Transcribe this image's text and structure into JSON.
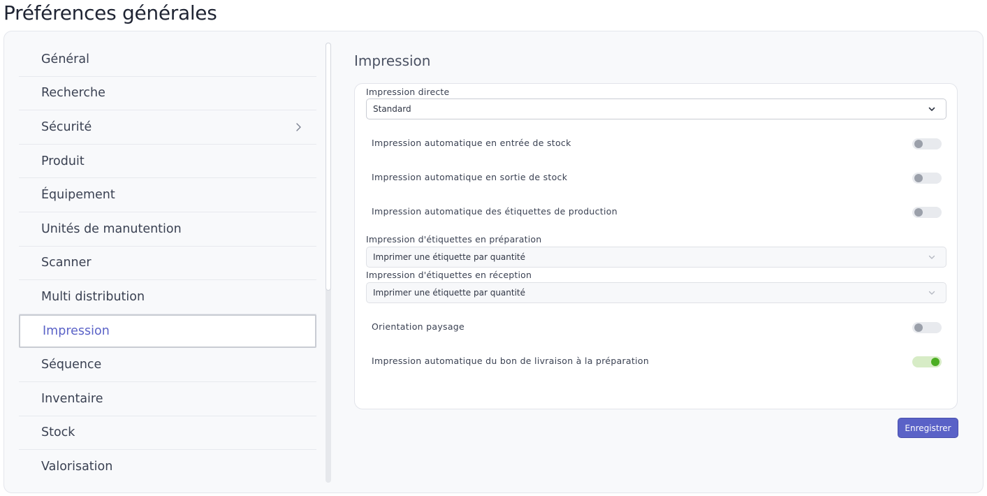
{
  "page": {
    "title": "Préférences générales"
  },
  "sidebar": {
    "items": [
      {
        "label": "Général"
      },
      {
        "label": "Recherche"
      },
      {
        "label": "Sécurité"
      },
      {
        "label": "Produit"
      },
      {
        "label": "Équipement"
      },
      {
        "label": "Unités de manutention"
      },
      {
        "label": "Scanner"
      },
      {
        "label": "Multi distribution"
      },
      {
        "label": "Impression"
      },
      {
        "label": "Séquence"
      },
      {
        "label": "Inventaire"
      },
      {
        "label": "Stock"
      },
      {
        "label": "Valorisation"
      }
    ],
    "active": "Impression"
  },
  "main": {
    "section_title": "Impression",
    "direct_print": {
      "label": "Impression directe",
      "value": "Standard"
    },
    "toggles": [
      {
        "label": "Impression automatique en entrée de stock",
        "on": false
      },
      {
        "label": "Impression automatique en sortie de stock",
        "on": false
      },
      {
        "label": "Impression automatique des étiquettes de production",
        "on": false
      }
    ],
    "prep_labels": {
      "label": "Impression d'étiquettes en préparation",
      "value": "Imprimer une étiquette par quantité"
    },
    "recep_labels": {
      "label": "Impression d'étiquettes en réception",
      "value": "Imprimer une étiquette par quantité"
    },
    "toggles2": [
      {
        "label": "Orientation paysage",
        "on": false
      },
      {
        "label": "Impression automatique du bon de livraison à la préparation",
        "on": true
      }
    ],
    "save_label": "Enregistrer"
  },
  "colors": {
    "accent": "#5a62c7",
    "toggle_on": "#4cae23"
  },
  "icons": {
    "submenu": "chevron-right-icon",
    "dropdown": "chevron-down-icon"
  }
}
